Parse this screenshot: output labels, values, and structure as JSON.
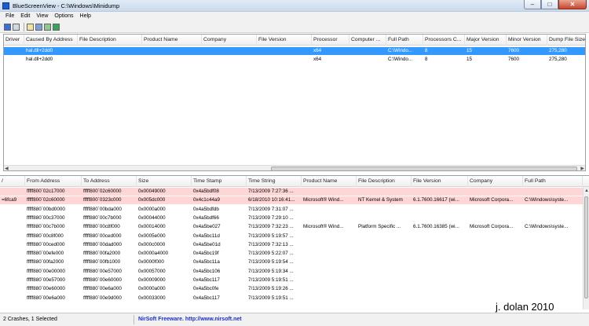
{
  "window": {
    "title": "BlueScreenView - C:\\Windows\\Minidump",
    "min": "–",
    "max": "□",
    "close": "✕"
  },
  "menu": [
    "File",
    "Edit",
    "View",
    "Options",
    "Help"
  ],
  "toolbar": [
    "save-icon",
    "copy-icon",
    "report-icon",
    "properties-icon",
    "refresh-icon",
    "exit-icon"
  ],
  "crashes": {
    "columns": [
      "Driver",
      "Caused By Address",
      "File Description",
      "Product Name",
      "Company",
      "File Version",
      "Processor",
      "Computer ...",
      "Full Path",
      "Processors C...",
      "Major Version",
      "Minor Version",
      "Dump File Size"
    ],
    "rows": [
      [
        "",
        "hal.dll+2dd0",
        "",
        "",
        "",
        "",
        "x64",
        "",
        "C:\\Windo...",
        "8",
        "15",
        "7600",
        "275,280"
      ],
      [
        "",
        "hal.dll+2dd0",
        "",
        "",
        "",
        "",
        "x64",
        "",
        "C:\\Windo...",
        "8",
        "15",
        "7600",
        "275,280"
      ]
    ]
  },
  "drivers": {
    "columns": [
      "/",
      "From Address",
      "To Address",
      "Size",
      "Time Stamp",
      "Time String",
      "Product Name",
      "File Description",
      "File Version",
      "Company",
      "Full Path"
    ],
    "rows": [
      [
        "",
        "fffff800`02c17000",
        "fffff800`02c60000",
        "0x00049000",
        "0x4a5bdf08",
        "7/13/2009 7:27:36 ...",
        "",
        "",
        "",
        "",
        ""
      ],
      [
        "=6fca9",
        "fffff800`02c60000",
        "fffff800`0323c000",
        "0x005dc000",
        "0x4c1c44a9",
        "6/18/2010 10:16:41...",
        "Microsoft® Wind...",
        "NT Kernel & System",
        "6.1.7600.16617 (wi...",
        "Microsoft Corpora...",
        "C:\\Windows\\syste..."
      ],
      [
        "",
        "fffff880`00bd0000",
        "fffff880`00bda000",
        "0x0000a000",
        "0x4a5bdfdb",
        "7/13/2009 7:31:07 ...",
        "",
        "",
        "",
        "",
        ""
      ],
      [
        "",
        "fffff880`00c37000",
        "fffff880`00c7b000",
        "0x00044000",
        "0x4a5bdf66",
        "7/13/2009 7:29:10 ...",
        "",
        "",
        "",
        "",
        ""
      ],
      [
        "",
        "fffff880`00c7b000",
        "fffff880`00c8f000",
        "0x00014000",
        "0x4a5be027",
        "7/13/2009 7:32:23 ...",
        "Microsoft® Wind...",
        "Platform Specific ...",
        "6.1.7600.16385 (wi...",
        "Microsoft Corpora...",
        "C:\\Windows\\syste..."
      ],
      [
        "",
        "fffff880`00c8f000",
        "fffff880`00ced000",
        "0x0005e000",
        "0x4a5bc11d",
        "7/13/2009 5:19:57 ...",
        "",
        "",
        "",
        "",
        ""
      ],
      [
        "",
        "fffff880`00ced000",
        "fffff880`00dad000",
        "0x000c0000",
        "0x4a5be01d",
        "7/13/2009 7:32:13 ...",
        "",
        "",
        "",
        "",
        ""
      ],
      [
        "",
        "fffff880`00efe000",
        "fffff880`00fa2000",
        "0x0000a4000",
        "0x4a5bc19f",
        "7/13/2009 5:22:07 ...",
        "",
        "",
        "",
        "",
        ""
      ],
      [
        "",
        "fffff880`00fa2000",
        "fffff880`00fb1000",
        "0x0000f000",
        "0x4a5bc11a",
        "7/13/2009 5:19:54 ...",
        "",
        "",
        "",
        "",
        ""
      ],
      [
        "",
        "fffff880`00e00000",
        "fffff880`00e57000",
        "0x00057000",
        "0x4a5bc106",
        "7/13/2009 5:19:34 ...",
        "",
        "",
        "",
        "",
        ""
      ],
      [
        "",
        "fffff880`00e57000",
        "fffff880`00e60000",
        "0x00009000",
        "0x4a5bc117",
        "7/13/2009 5:19:51 ...",
        "",
        "",
        "",
        "",
        ""
      ],
      [
        "",
        "fffff880`00e60000",
        "fffff880`00e6a000",
        "0x0000a000",
        "0x4a5bc0fe",
        "7/13/2009 5:19:26 ...",
        "",
        "",
        "",
        "",
        ""
      ],
      [
        "",
        "fffff880`00e6a000",
        "fffff880`00e9d000",
        "0x00033000",
        "0x4a5bc117",
        "7/13/2009 5:19:51 ...",
        "",
        "",
        "",
        "",
        ""
      ]
    ]
  },
  "status": {
    "count": "2 Crashes, 1 Selected",
    "link": "NirSoft Freeware.  http://www.nirsoft.net"
  },
  "watermark": "j. dolan 2010"
}
